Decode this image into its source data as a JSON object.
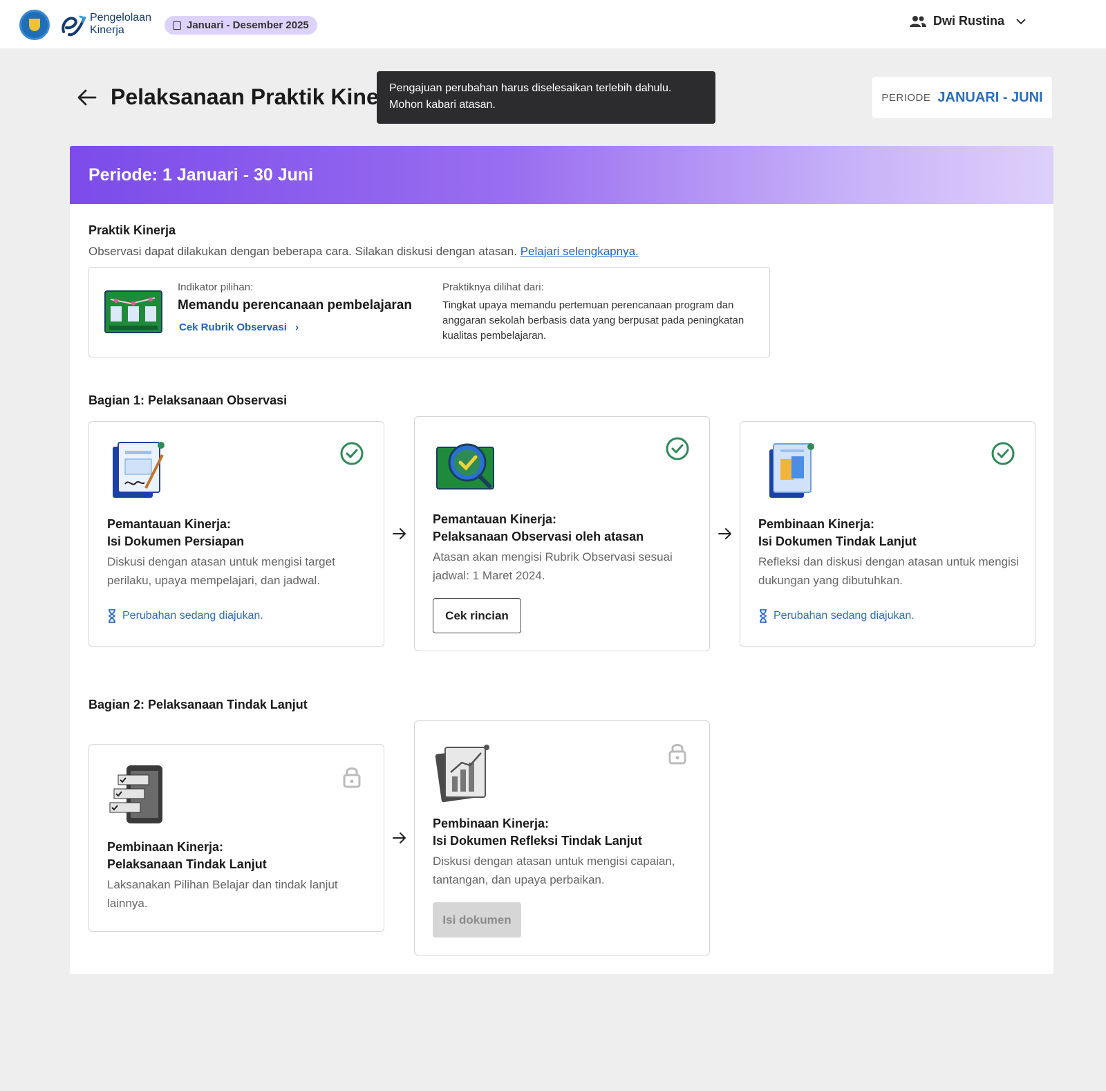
{
  "topbar": {
    "app_name_line1": "Pengelolaan",
    "app_name_line2": "Kinerja",
    "year_range": "Januari - Desember 2025",
    "user_name": "Dwi Rustina"
  },
  "page": {
    "title": "Pelaksanaan Praktik Kiner",
    "tooltip_line1": "Pengajuan perubahan harus diselesaikan terlebih dahulu.",
    "tooltip_line2": "Mohon kabari atasan.",
    "periode_label": "PERIODE",
    "periode_value": "JANUARI - JUNI"
  },
  "banner": {
    "title": "Periode: 1 Januari - 30 Juni"
  },
  "praktik": {
    "heading": "Praktik Kinerja",
    "description": "Observasi dapat dilakukan dengan beberapa cara. Silakan diskusi dengan atasan.",
    "learn_more": "Pelajari selengkapnya.",
    "indicator_label": "Indikator pilihan:",
    "indicator_title": "Memandu perencanaan pembelajaran",
    "rubric_link": "Cek Rubrik Observasi",
    "seen_from_label": "Praktiknya dilihat dari:",
    "seen_from_desc": "Tingkat upaya memandu pertemuan perencanaan program dan anggaran sekolah berbasis data yang berpusat pada peningkatan kualitas pembelajaran."
  },
  "section1": {
    "heading": "Bagian 1: Pelaksanaan Observasi",
    "cards": [
      {
        "title_line1": "Pemantauan Kinerja:",
        "title_line2": "Isi Dokumen Persiapan",
        "description": "Diskusi dengan atasan untuk mengisi target perilaku, upaya mempelajari, dan jadwal.",
        "status": "completed",
        "pending_text": "Perubahan sedang diajukan.",
        "icon": "document-sign-icon"
      },
      {
        "title_line1": "Pemantauan Kinerja:",
        "title_line2": "Pelaksanaan Observasi oleh atasan",
        "description": "Atasan akan mengisi Rubrik Observasi sesuai jadwal: 1 Maret 2024.",
        "status": "completed",
        "button_label": "Cek rincian",
        "icon": "magnifier-check-icon"
      },
      {
        "title_line1": "Pembinaan Kinerja:",
        "title_line2": "Isi Dokumen Tindak Lanjut",
        "description": "Refleksi dan diskusi dengan atasan untuk mengisi dukungan yang dibutuhkan.",
        "status": "completed",
        "pending_text": "Perubahan sedang diajukan.",
        "icon": "document-faces-icon"
      }
    ]
  },
  "section2": {
    "heading": "Bagian 2: Pelaksanaan Tindak Lanjut",
    "cards": [
      {
        "title_line1": "Pembinaan Kinerja:",
        "title_line2": "Pelaksanaan Tindak Lanjut",
        "description": "Laksanakan Pilihan Belajar dan tindak lanjut lainnya.",
        "status": "locked",
        "icon": "checklist-phone-icon"
      },
      {
        "title_line1": "Pembinaan Kinerja:",
        "title_line2": "Isi Dokumen Refleksi Tindak Lanjut",
        "description": "Diskusi dengan atasan untuk mengisi capaian, tantangan, dan upaya perbaikan.",
        "status": "locked",
        "button_label": "Isi dokumen",
        "icon": "report-chart-icon"
      }
    ]
  },
  "colors": {
    "accent": "#7c4bea",
    "link": "#1f62c4",
    "success": "#2e8b57",
    "locked": "#bbbbbb"
  }
}
